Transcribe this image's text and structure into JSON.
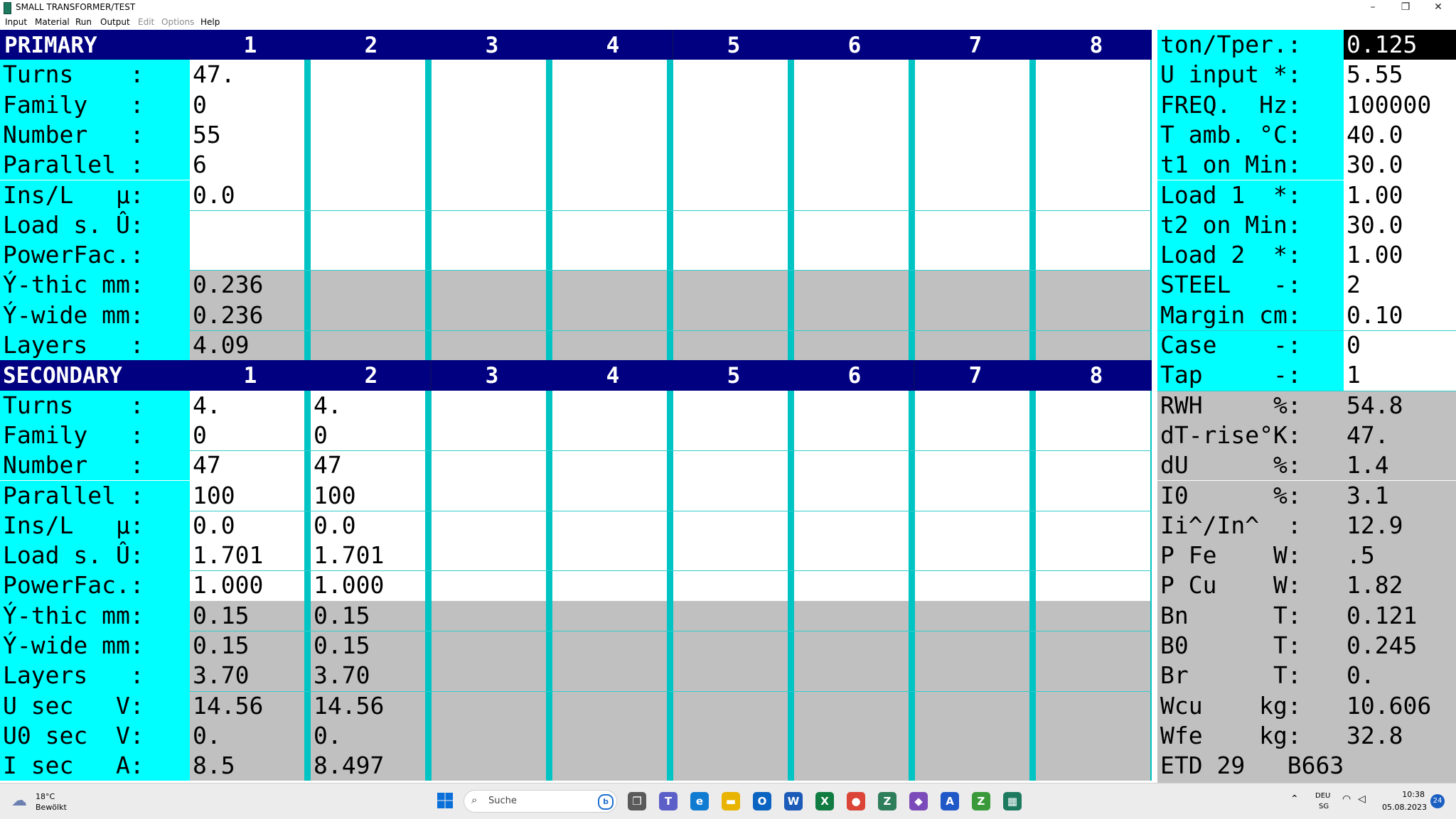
{
  "window": {
    "title": "SMALL TRANSFORMER/TEST",
    "min_glyph": "–",
    "restore_glyph": "❐",
    "close_glyph": "✕"
  },
  "menu": [
    {
      "label": "Input",
      "enabled": true
    },
    {
      "label": "Material",
      "enabled": true
    },
    {
      "label": "Run",
      "enabled": true
    },
    {
      "label": "Output",
      "enabled": true
    },
    {
      "label": "Edit",
      "enabled": false
    },
    {
      "label": "Options",
      "enabled": false
    },
    {
      "label": "Help",
      "enabled": true
    }
  ],
  "primary": {
    "header": "PRIMARY",
    "columns": [
      "1",
      "2",
      "3",
      "4",
      "5",
      "6",
      "7",
      "8"
    ],
    "rows": [
      {
        "label": "Turns    :",
        "values": [
          "47."
        ]
      },
      {
        "label": "Family   :",
        "values": [
          "0"
        ]
      },
      {
        "label": "Number   :",
        "values": [
          "55"
        ]
      },
      {
        "label": "Parallel :",
        "values": [
          "6"
        ]
      },
      {
        "label": "Ins/L   µ:",
        "values": [
          "0.0"
        ]
      },
      {
        "label": "Load s. Û:",
        "values": [
          ""
        ]
      },
      {
        "label": "PowerFac.:",
        "values": [
          ""
        ]
      },
      {
        "label": "Ý-thic mm:",
        "values": [
          "0.236"
        ]
      },
      {
        "label": "Ý-wide mm:",
        "values": [
          "0.236"
        ]
      },
      {
        "label": "Layers   :",
        "values": [
          "4.09"
        ]
      }
    ]
  },
  "secondary": {
    "header": "SECONDARY",
    "columns": [
      "1",
      "2",
      "3",
      "4",
      "5",
      "6",
      "7",
      "8"
    ],
    "rows": [
      {
        "label": "Turns    :",
        "values": [
          "4.",
          "4."
        ]
      },
      {
        "label": "Family   :",
        "values": [
          "0",
          "0"
        ]
      },
      {
        "label": "Number   :",
        "values": [
          "47",
          "47"
        ]
      },
      {
        "label": "Parallel :",
        "values": [
          "100",
          "100"
        ]
      },
      {
        "label": "Ins/L   µ:",
        "values": [
          "0.0",
          "0.0"
        ]
      },
      {
        "label": "Load s. Û:",
        "values": [
          "1.701",
          "1.701"
        ]
      },
      {
        "label": "PowerFac.:",
        "values": [
          "1.000",
          "1.000"
        ]
      },
      {
        "label": "Ý-thic mm:",
        "values": [
          "0.15",
          "0.15"
        ]
      },
      {
        "label": "Ý-wide mm:",
        "values": [
          "0.15",
          "0.15"
        ]
      },
      {
        "label": "Layers   :",
        "values": [
          "3.70",
          "3.70"
        ]
      },
      {
        "label": "U sec   V:",
        "values": [
          "14.56",
          "14.56"
        ]
      },
      {
        "label": "U0 sec  V:",
        "values": [
          "0.",
          "0."
        ]
      },
      {
        "label": "I sec   A:",
        "values": [
          "8.5",
          "8.497"
        ]
      }
    ]
  },
  "params": [
    {
      "label": "ton/Tper.:",
      "value": "0.125"
    },
    {
      "label": "U input *:",
      "value": "5.55"
    },
    {
      "label": "FREQ.  Hz:",
      "value": "100000"
    },
    {
      "label": "T amb. °C:",
      "value": "40.0"
    },
    {
      "label": "t1 on Min:",
      "value": "30.0"
    },
    {
      "label": "Load 1  *:",
      "value": "1.00"
    },
    {
      "label": "t2 on Min:",
      "value": "30.0"
    },
    {
      "label": "Load 2  *:",
      "value": "1.00"
    },
    {
      "label": "STEEL   -:",
      "value": "2"
    },
    {
      "label": "Margin cm:",
      "value": "0.10"
    },
    {
      "label": "Case    -:",
      "value": "0"
    },
    {
      "label": "Tap     -:",
      "value": "1"
    },
    {
      "label": "RWH     %:",
      "value": "54.8"
    },
    {
      "label": "dT-rise°K:",
      "value": "47."
    },
    {
      "label": "dU      %:",
      "value": "1.4"
    },
    {
      "label": "I0      %:",
      "value": "3.1"
    },
    {
      "label": "Ii^/In^  :",
      "value": "12.9"
    },
    {
      "label": "P Fe    W:",
      "value": ".5"
    },
    {
      "label": "P Cu    W:",
      "value": "1.82"
    },
    {
      "label": "Bn      T:",
      "value": "0.121"
    },
    {
      "label": "B0      T:",
      "value": "0.245"
    },
    {
      "label": "Br      T:",
      "value": "0."
    },
    {
      "label": "Wcu    kg:",
      "value": "10.606"
    },
    {
      "label": "Wfe    kg:",
      "value": "32.8"
    }
  ],
  "footer": "ETD 29   B663",
  "taskbar": {
    "weather_temp": "18°C",
    "weather_desc": "Bewölkt",
    "search_placeholder": "Suche",
    "lang_top": "DEU",
    "lang_bottom": "SG",
    "time": "10:38",
    "date": "05.08.2023",
    "notification_count": "24",
    "apps": [
      {
        "name": "task-view-icon",
        "glyph": "❐",
        "color": "#5a5a5a"
      },
      {
        "name": "teams-icon",
        "glyph": "T",
        "color": "#5b5fc7"
      },
      {
        "name": "edge-icon",
        "glyph": "e",
        "color": "#0f7bd1"
      },
      {
        "name": "file-explorer-icon",
        "glyph": "▬",
        "color": "#e8b400"
      },
      {
        "name": "outlook-icon",
        "glyph": "O",
        "color": "#0a64c1"
      },
      {
        "name": "word-icon",
        "glyph": "W",
        "color": "#1c5bb8"
      },
      {
        "name": "excel-icon",
        "glyph": "X",
        "color": "#107c41"
      },
      {
        "name": "chrome-icon",
        "glyph": "●",
        "color": "#db4437"
      },
      {
        "name": "z-app-icon",
        "glyph": "Z",
        "color": "#2e7d5b"
      },
      {
        "name": "visual-studio-icon",
        "glyph": "◆",
        "color": "#7b4bb9"
      },
      {
        "name": "a-app-icon",
        "glyph": "A",
        "color": "#2058c8"
      },
      {
        "name": "z-app-2-icon",
        "glyph": "Z",
        "color": "#3a9a3a"
      },
      {
        "name": "transformer-app-icon",
        "glyph": "▦",
        "color": "#1d7a5f"
      }
    ]
  }
}
